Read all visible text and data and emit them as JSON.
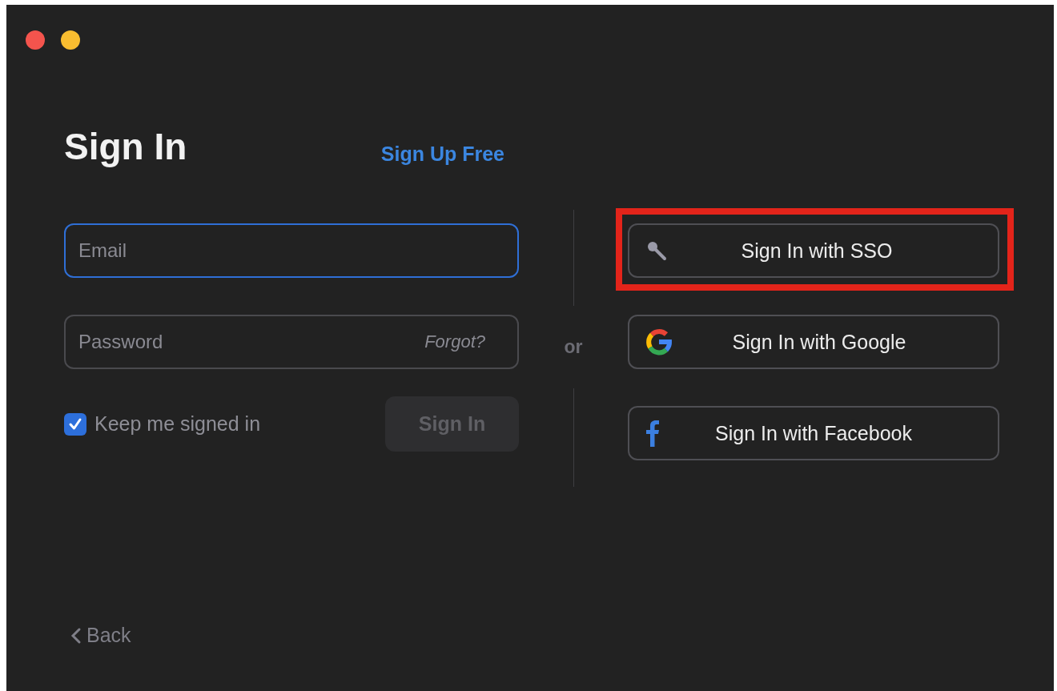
{
  "window": {
    "controls": [
      {
        "kind": "close"
      },
      {
        "kind": "minimize"
      }
    ]
  },
  "title": "Sign In",
  "signup_link": "Sign Up Free",
  "email": {
    "placeholder": "Email",
    "focused": true
  },
  "password": {
    "placeholder": "Password",
    "forgot": "Forgot?"
  },
  "keep_signed_in": {
    "label": "Keep me signed in",
    "checked": true
  },
  "sign_in_button": {
    "label": "Sign In",
    "disabled": true
  },
  "separator": "or",
  "providers": [
    {
      "kind": "key",
      "label": "Sign In with SSO",
      "highlighted": true
    },
    {
      "kind": "google",
      "label": "Sign In with Google",
      "highlighted": false
    },
    {
      "kind": "facebook",
      "label": "Sign In with Facebook",
      "highlighted": false
    }
  ],
  "back": {
    "label": "Back"
  }
}
